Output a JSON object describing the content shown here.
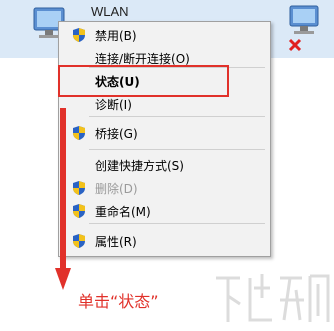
{
  "adapter": {
    "name": "WLAN"
  },
  "menu": {
    "items": [
      {
        "label": "禁用(B)",
        "shield": true
      },
      {
        "label": "连接/断开连接(O)",
        "shield": false
      },
      {
        "label": "状态(U)",
        "shield": false
      },
      {
        "label": "诊断(I)",
        "shield": false
      },
      {
        "label": "桥接(G)",
        "shield": true
      },
      {
        "label": "创建快捷方式(S)",
        "shield": false
      },
      {
        "label": "删除(D)",
        "shield": true
      },
      {
        "label": "重命名(M)",
        "shield": true
      },
      {
        "label": "属性(R)",
        "shield": true
      }
    ]
  },
  "annotation": {
    "caption": "单击“状态”",
    "color": "#e1312a"
  },
  "colors": {
    "menu_bg": "#f2f2f2",
    "accent_red": "#e1312a",
    "strip": "#dbe9f7"
  },
  "icons": [
    "network-adapter-icon",
    "network-disconnected-icon",
    "uac-shield-icon",
    "watermark-logo"
  ]
}
